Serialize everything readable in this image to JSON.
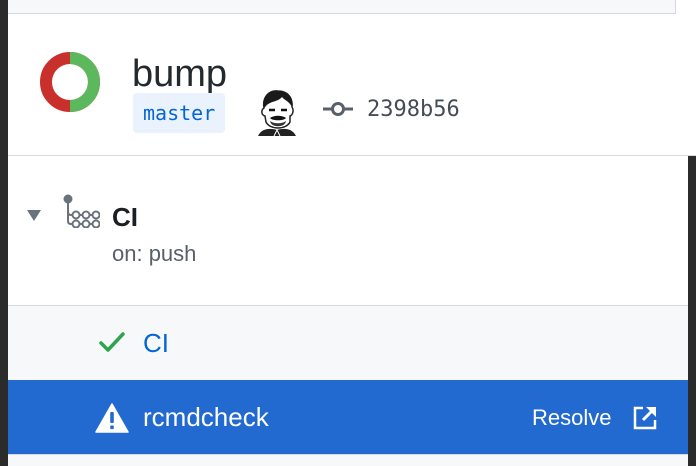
{
  "commit": {
    "title": "bump",
    "branch": "master",
    "sha": "2398b56",
    "status_ring_colors": {
      "success": "#5cb85c",
      "failure": "#c9302c"
    }
  },
  "workflow": {
    "name": "CI",
    "trigger": "on: push",
    "icon": "workflow-icon",
    "expanded": true
  },
  "jobs": [
    {
      "label": "CI",
      "status": "success",
      "icon": "check-icon",
      "color": "#2ea44f"
    },
    {
      "label": "rcmdcheck",
      "status": "warning",
      "icon": "alert-icon",
      "selected": true,
      "action_label": "Resolve",
      "action_icon": "link-external-icon"
    }
  ],
  "colors": {
    "accent": "#0366d6",
    "selected_row": "#2269d0",
    "branch_bg": "#eaf2fd"
  }
}
